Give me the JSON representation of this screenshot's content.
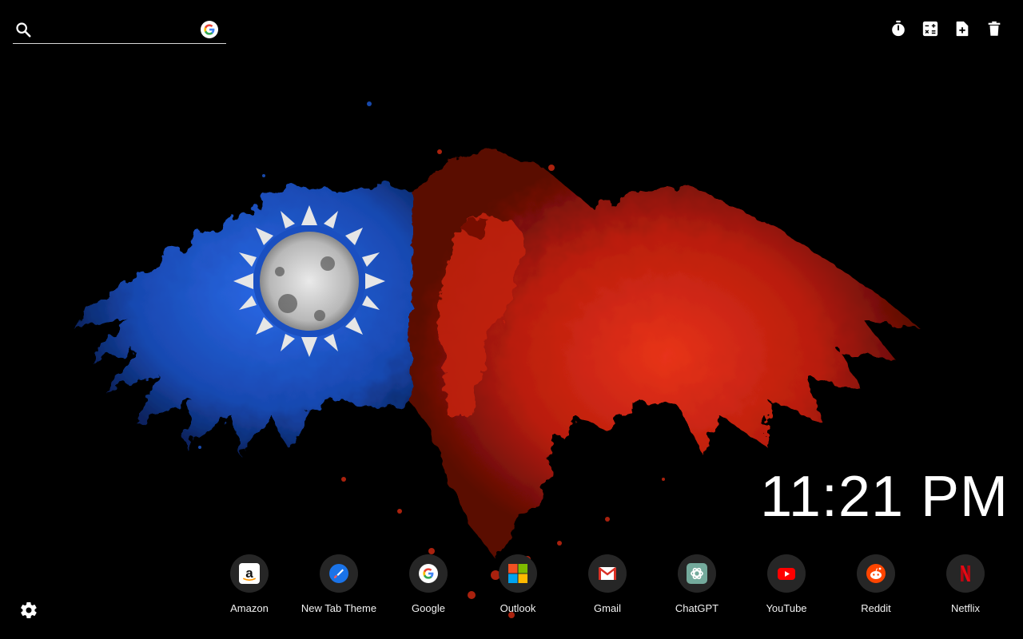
{
  "search": {
    "placeholder": "",
    "value": "",
    "engine_icon": "google-g-icon"
  },
  "toolbar": {
    "icons": [
      "timer-icon",
      "calculator-icon",
      "new-note-icon",
      "trash-icon"
    ]
  },
  "wallpaper": {
    "subject": "eagle-with-taiwan-flag-splatter",
    "colors": {
      "background": "#000000",
      "blue": "#1e5bd6",
      "red": "#d42a12",
      "white": "#e6e6e6"
    }
  },
  "clock": {
    "time": "11:21 PM"
  },
  "shortcuts": [
    {
      "label": "Amazon",
      "icon": "amazon-icon"
    },
    {
      "label": "New Tab Theme",
      "icon": "paintbrush-icon"
    },
    {
      "label": "Google",
      "icon": "google-icon"
    },
    {
      "label": "Outlook",
      "icon": "microsoft-icon"
    },
    {
      "label": "Gmail",
      "icon": "gmail-icon"
    },
    {
      "label": "ChatGPT",
      "icon": "chatgpt-icon"
    },
    {
      "label": "YouTube",
      "icon": "youtube-icon"
    },
    {
      "label": "Reddit",
      "icon": "reddit-icon"
    },
    {
      "label": "Netflix",
      "icon": "netflix-icon"
    }
  ],
  "settings": {
    "icon": "gear-icon"
  }
}
